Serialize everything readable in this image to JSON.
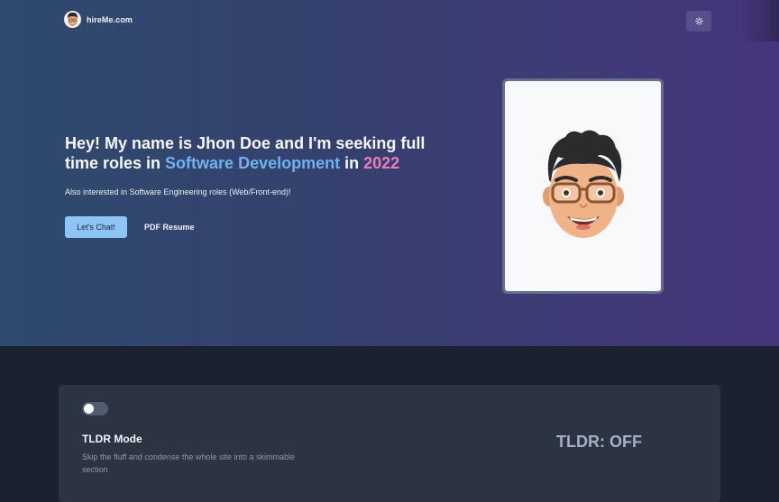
{
  "header": {
    "logo_text": "hireMe.com",
    "theme_icon": "sun-icon"
  },
  "hero": {
    "heading_prefix": "Hey! My name is Jhon Doe and I'm seeking full time roles in ",
    "heading_field": "Software Development",
    "heading_mid": " in ",
    "heading_year": "2022",
    "subheading": "Also interested in Software Engineering roles (Web/Front-end)!",
    "cta_primary": "Let's Chat!",
    "cta_secondary": "PDF Resume"
  },
  "tldr": {
    "title": "TLDR Mode",
    "description": "Skip the fluff and condense the whole site into a skimmable section",
    "status": "TLDR: OFF",
    "enabled": false
  },
  "colors": {
    "accent_blue": "#6fb3ee",
    "accent_pink": "#ef7cb6",
    "button_primary": "#8dc6f5"
  }
}
